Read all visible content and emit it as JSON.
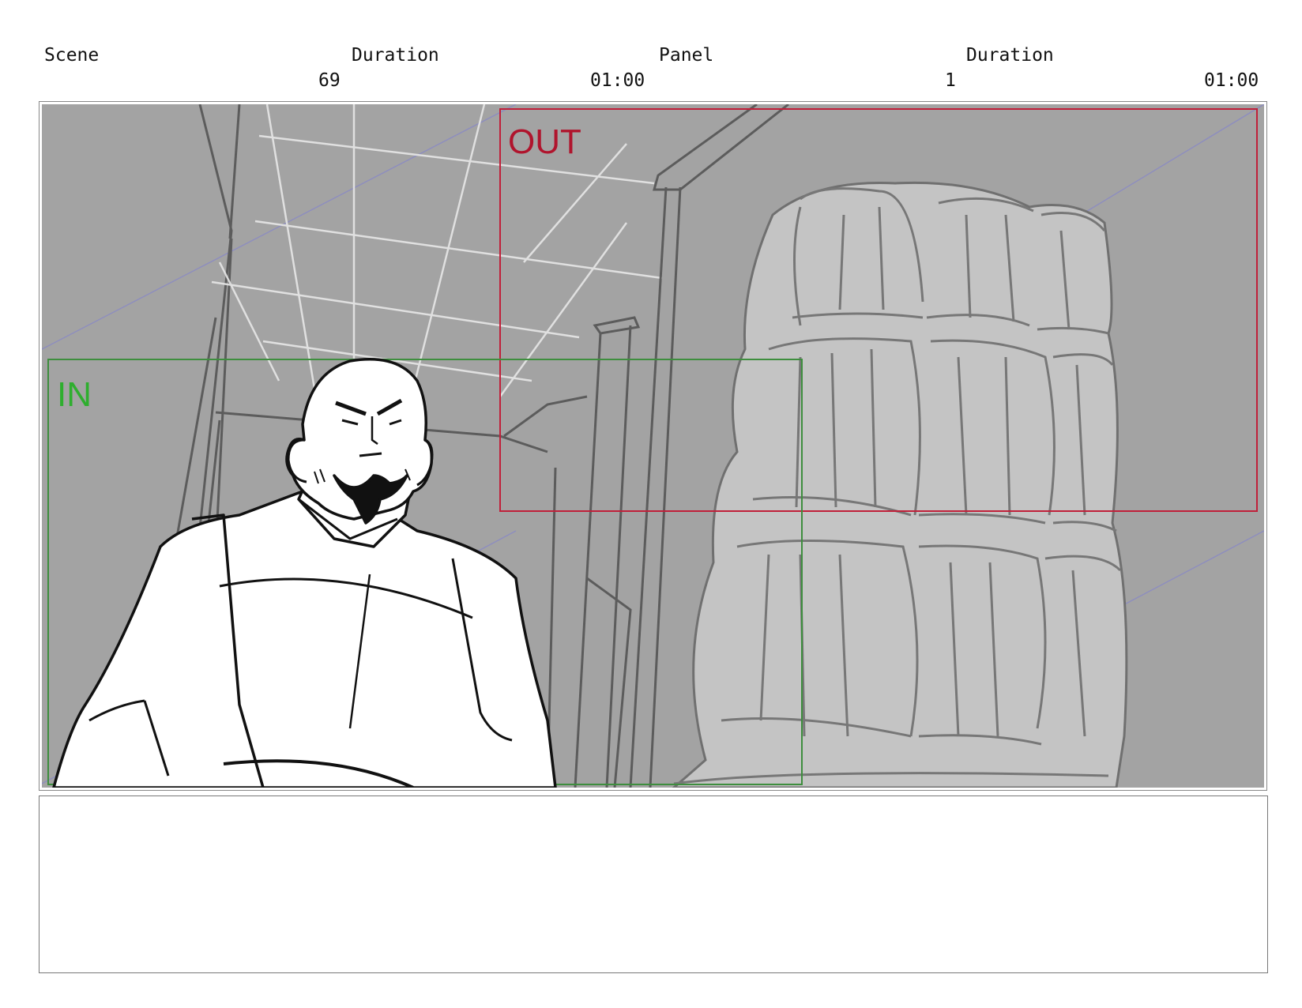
{
  "header": {
    "scene_label": "Scene",
    "scene_duration_label": "Duration",
    "panel_label": "Panel",
    "panel_duration_label": "Duration",
    "scene_value": "69",
    "scene_duration_value": "01:00",
    "panel_value": "1",
    "panel_duration_value": "01:00"
  },
  "panel": {
    "in_label": "IN",
    "out_label": "OUT",
    "colors": {
      "background": "#a3a3a3",
      "in_frame": "#3e8e3e",
      "out_frame": "#c0203a",
      "barrels": "#c4c4c4",
      "guide_lines": "#8f8fc0"
    }
  },
  "notes": {
    "text": ""
  }
}
